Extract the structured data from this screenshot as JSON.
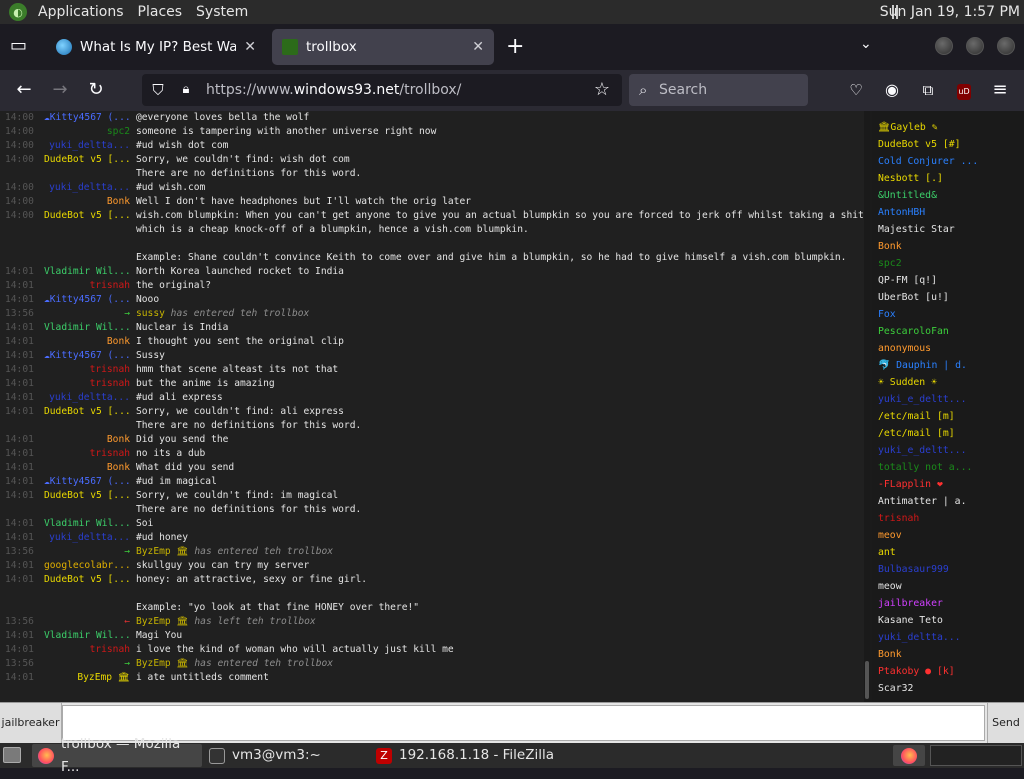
{
  "top_panel": {
    "menus": [
      "Applications",
      "Places",
      "System"
    ],
    "clock": "Sun Jan 19,  1:57 PM"
  },
  "tabs": [
    {
      "title": "What Is My IP? Best Way To",
      "active": false
    },
    {
      "title": "trollbox",
      "active": true
    }
  ],
  "navbar": {
    "url_prefix": "https://www.",
    "url_host": "windows93.net",
    "url_path": "/trollbox/",
    "search_placeholder": "Search"
  },
  "chat": {
    "messages": [
      {
        "time": "14:00",
        "nick": "☁Kitty4567 (...",
        "color": "#4a6cff",
        "align": "left",
        "text": "@everyone loves bella the wolf"
      },
      {
        "time": "14:00",
        "nick": "spc2",
        "color": "#1a8a1a",
        "text": "someone is tampering with another universe right now"
      },
      {
        "time": "14:00",
        "nick": "yuki_deltta...",
        "color": "#2a3fd0",
        "text": "#ud wish dot com"
      },
      {
        "time": "14:00",
        "nick": "DudeBot v5 [...",
        "color": "#e8d800",
        "align": "left",
        "text": "Sorry, we couldn't find: wish dot com"
      },
      {
        "time": "",
        "nick": "",
        "color": "#e8d800",
        "text": "There are no definitions for this word."
      },
      {
        "time": "14:00",
        "nick": "yuki_deltta...",
        "color": "#2a3fd0",
        "text": "#ud wish.com"
      },
      {
        "time": "14:00",
        "nick": "Bonk",
        "color": "#ff9a2e",
        "text": "Well I don't have headphones but I'll watch the orig later"
      },
      {
        "time": "14:00",
        "nick": "DudeBot v5 [...",
        "color": "#e8d800",
        "align": "left",
        "tall": true,
        "text": "wish.com blumpkin: When you can't get anyone to give you an actual blumpkin so you are forced to jerk off whilst taking a shit which is a cheap knock-off of a blumpkin, hence a vish.com blumpkin."
      },
      {
        "time": "",
        "nick": "",
        "color": "#e8d800",
        "text": " "
      },
      {
        "time": "",
        "nick": "",
        "color": "#e8d800",
        "tall": true,
        "text": "Example: Shane couldn't convince Keith to come over and give him a blumpkin, so he had to give himself a vish.com blumpkin."
      },
      {
        "time": "14:01",
        "nick": "Vladimir Wil...",
        "color": "#3ccf6a",
        "align": "left",
        "text": "North Korea launched rocket to India"
      },
      {
        "time": "14:01",
        "nick": "trisnah",
        "color": "#d01818",
        "text": "the original?"
      },
      {
        "time": "14:01",
        "nick": "☁Kitty4567 (...",
        "color": "#4a6cff",
        "align": "left",
        "text": "Nooo"
      },
      {
        "time": "13:56",
        "nick": "→",
        "color": "#3ccf3c",
        "sys": true,
        "who": "sussy",
        "text": " has entered teh trollbox"
      },
      {
        "time": "14:01",
        "nick": "Vladimir Wil...",
        "color": "#3ccf6a",
        "align": "left",
        "text": "Nuclear is India"
      },
      {
        "time": "14:01",
        "nick": "Bonk",
        "color": "#ff9a2e",
        "text": "I thought you sent the original clip"
      },
      {
        "time": "14:01",
        "nick": "☁Kitty4567 (...",
        "color": "#4a6cff",
        "align": "left",
        "text": "Sussy"
      },
      {
        "time": "14:01",
        "nick": "trisnah",
        "color": "#d01818",
        "text": "hmm that scene alteast its not that"
      },
      {
        "time": "14:01",
        "nick": "trisnah",
        "color": "#d01818",
        "text": "but the anime is amazing"
      },
      {
        "time": "14:01",
        "nick": "yuki_deltta...",
        "color": "#2a3fd0",
        "text": "#ud ali express"
      },
      {
        "time": "14:01",
        "nick": "DudeBot v5 [...",
        "color": "#e8d800",
        "align": "left",
        "text": "Sorry, we couldn't find: ali express"
      },
      {
        "time": "",
        "nick": "",
        "color": "#e8d800",
        "text": "There are no definitions for this word."
      },
      {
        "time": "14:01",
        "nick": "Bonk",
        "color": "#ff9a2e",
        "text": "Did you send the"
      },
      {
        "time": "14:01",
        "nick": "trisnah",
        "color": "#d01818",
        "text": "no its a dub"
      },
      {
        "time": "14:01",
        "nick": "Bonk",
        "color": "#ff9a2e",
        "text": "What did you send"
      },
      {
        "time": "14:01",
        "nick": "☁Kitty4567 (...",
        "color": "#4a6cff",
        "align": "left",
        "text": "#ud im magical"
      },
      {
        "time": "14:01",
        "nick": "DudeBot v5 [...",
        "color": "#e8d800",
        "align": "left",
        "text": "Sorry, we couldn't find: im magical"
      },
      {
        "time": "",
        "nick": "",
        "color": "#e8d800",
        "text": "There are no definitions for this word."
      },
      {
        "time": "14:01",
        "nick": "Vladimir Wil...",
        "color": "#3ccf6a",
        "align": "left",
        "text": "Soi"
      },
      {
        "time": "14:01",
        "nick": "yuki_deltta...",
        "color": "#2a3fd0",
        "text": "#ud honey"
      },
      {
        "time": "13:56",
        "nick": "→",
        "color": "#3ccf3c",
        "sys": true,
        "who": "ByzEmp 🏛",
        "text": " has entered teh trollbox"
      },
      {
        "time": "14:01",
        "nick": "googlecolabr...",
        "color": "#e0b000",
        "align": "left",
        "text": "skullguy you can try my server"
      },
      {
        "time": "14:01",
        "nick": "DudeBot v5 [...",
        "color": "#e8d800",
        "align": "left",
        "text": "honey: an attractive, sexy or fine girl."
      },
      {
        "time": "",
        "nick": "",
        "color": "#e8d800",
        "text": " "
      },
      {
        "time": "",
        "nick": "",
        "color": "#e8d800",
        "text": "Example: \"yo look at that fine HONEY over there!\""
      },
      {
        "time": "13:56",
        "nick": "←",
        "color": "#e03030",
        "sys": true,
        "who": "ByzEmp 🏛",
        "text": " has left teh trollbox"
      },
      {
        "time": "14:01",
        "nick": "Vladimir Wil...",
        "color": "#3ccf6a",
        "align": "left",
        "text": "Magi You"
      },
      {
        "time": "14:01",
        "nick": "trisnah",
        "color": "#d01818",
        "text": "i love the kind of woman who will actually just kill me"
      },
      {
        "time": "13:56",
        "nick": "→",
        "color": "#3ccf3c",
        "sys": true,
        "who": "ByzEmp 🏛",
        "text": " has entered teh trollbox"
      },
      {
        "time": "14:01",
        "nick": "ByzEmp 🏛",
        "color": "#e8d800",
        "text": "i ate untitleds comment"
      }
    ]
  },
  "users": [
    {
      "name": "🏛Gayleb ✎",
      "color": "#e8d800"
    },
    {
      "name": "DudeBot v5 [#]",
      "color": "#e8d800"
    },
    {
      "name": "Cold Conjurer ...",
      "color": "#2a80ff"
    },
    {
      "name": "Nesbott [.]",
      "color": "#e8d800"
    },
    {
      "name": "&Untitled&",
      "color": "#3ccf6a"
    },
    {
      "name": "AntonHBH",
      "color": "#2a80ff"
    },
    {
      "name": "Majestic Star",
      "color": "#e4e4e4"
    },
    {
      "name": "Bonk",
      "color": "#ff9a2e"
    },
    {
      "name": "spc2",
      "color": "#1a8a1a"
    },
    {
      "name": "QP-FM [q!]",
      "color": "#e4e4e4"
    },
    {
      "name": "UberBot [u!]",
      "color": "#e4e4e4"
    },
    {
      "name": "Fox",
      "color": "#2a80ff"
    },
    {
      "name": "PescaroloFan",
      "color": "#3ccf3c"
    },
    {
      "name": "anonymous",
      "color": "#ff9a2e"
    },
    {
      "name": "🐬 Dauphin | d.",
      "color": "#2a80ff"
    },
    {
      "name": "☀ Sudden ☀",
      "color": "#e8d800"
    },
    {
      "name": "yuki_e_deltt...",
      "color": "#2a3fd0"
    },
    {
      "name": "/etc/mail [m]",
      "color": "#e8d800"
    },
    {
      "name": "/etc/mail [m]",
      "color": "#e8d800"
    },
    {
      "name": "yuki_e_deltt...",
      "color": "#2a3fd0"
    },
    {
      "name": "totally not a...",
      "color": "#1a8a1a"
    },
    {
      "name": "-FLapplin ❤",
      "color": "#ff3030"
    },
    {
      "name": "Antimatter | a.",
      "color": "#e4e4e4"
    },
    {
      "name": "trisnah",
      "color": "#d01818"
    },
    {
      "name": "meov",
      "color": "#ff9a2e"
    },
    {
      "name": "ant",
      "color": "#e8d800"
    },
    {
      "name": "Bulbasaur999",
      "color": "#2a3fd0"
    },
    {
      "name": "meow",
      "color": "#e4e4e4"
    },
    {
      "name": "jailbreaker",
      "color": "#d040ff"
    },
    {
      "name": "Kasane Teto",
      "color": "#e4e4e4"
    },
    {
      "name": "yuki_deltta...",
      "color": "#2a3fd0"
    },
    {
      "name": "Bonk",
      "color": "#ff9a2e"
    },
    {
      "name": "Ptakoby ● [k]",
      "color": "#ff3030"
    },
    {
      "name": "Scar32",
      "color": "#e4e4e4"
    }
  ],
  "composer": {
    "nick": "jailbreaker",
    "input_value": "",
    "send_label": "Send"
  },
  "taskbar": {
    "tasks": [
      "trollbox — Mozilla F...",
      "vm3@vm3:~",
      "192.168.1.18 - FileZilla"
    ]
  }
}
